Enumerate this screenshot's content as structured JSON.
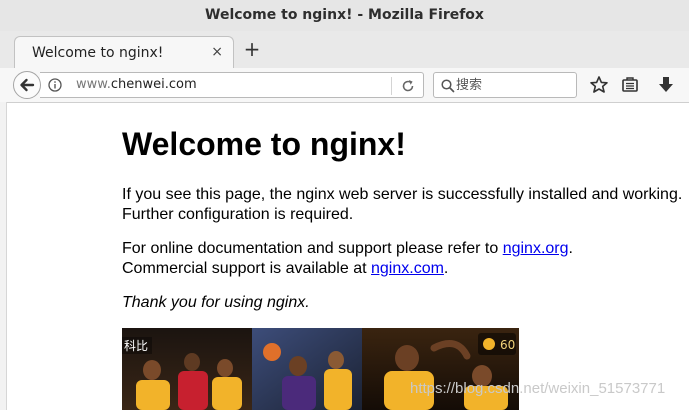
{
  "window": {
    "title": "Welcome to nginx! - Mozilla Firefox"
  },
  "tabs": [
    {
      "label": "Welcome to nginx!",
      "close_glyph": "×",
      "active": true
    }
  ],
  "new_tab_glyph": "+",
  "navbar": {
    "url_prefix": "www.",
    "url_domain": "chenwei.com",
    "search_placeholder": "搜索",
    "icons": [
      "back-arrow-icon",
      "info-icon",
      "reload-icon",
      "search-icon",
      "bookmark-star-icon",
      "reading-list-icon",
      "download-icon"
    ]
  },
  "page": {
    "heading": "Welcome to nginx!",
    "p1_line1": "If you see this page, the nginx web server is successfully installed and working.",
    "p1_line2": "Further configuration is required.",
    "p2_line1_text": "For online documentation and support please refer to ",
    "p2_line1_link": "nginx.org",
    "p2_line1_end": ".",
    "p2_line2_text": "Commercial support is available at ",
    "p2_line2_link": "nginx.com",
    "p2_line2_end": ".",
    "thanks": "Thank you for using nginx."
  },
  "image": {
    "badge_left": "科比",
    "badge_right": "60"
  },
  "watermark": "https://blog.csdn.net/weixin_51573771",
  "colors": {
    "link": "#0000ee",
    "lakers_gold": "#f2b32a",
    "lakers_purple": "#4b2a7b"
  }
}
